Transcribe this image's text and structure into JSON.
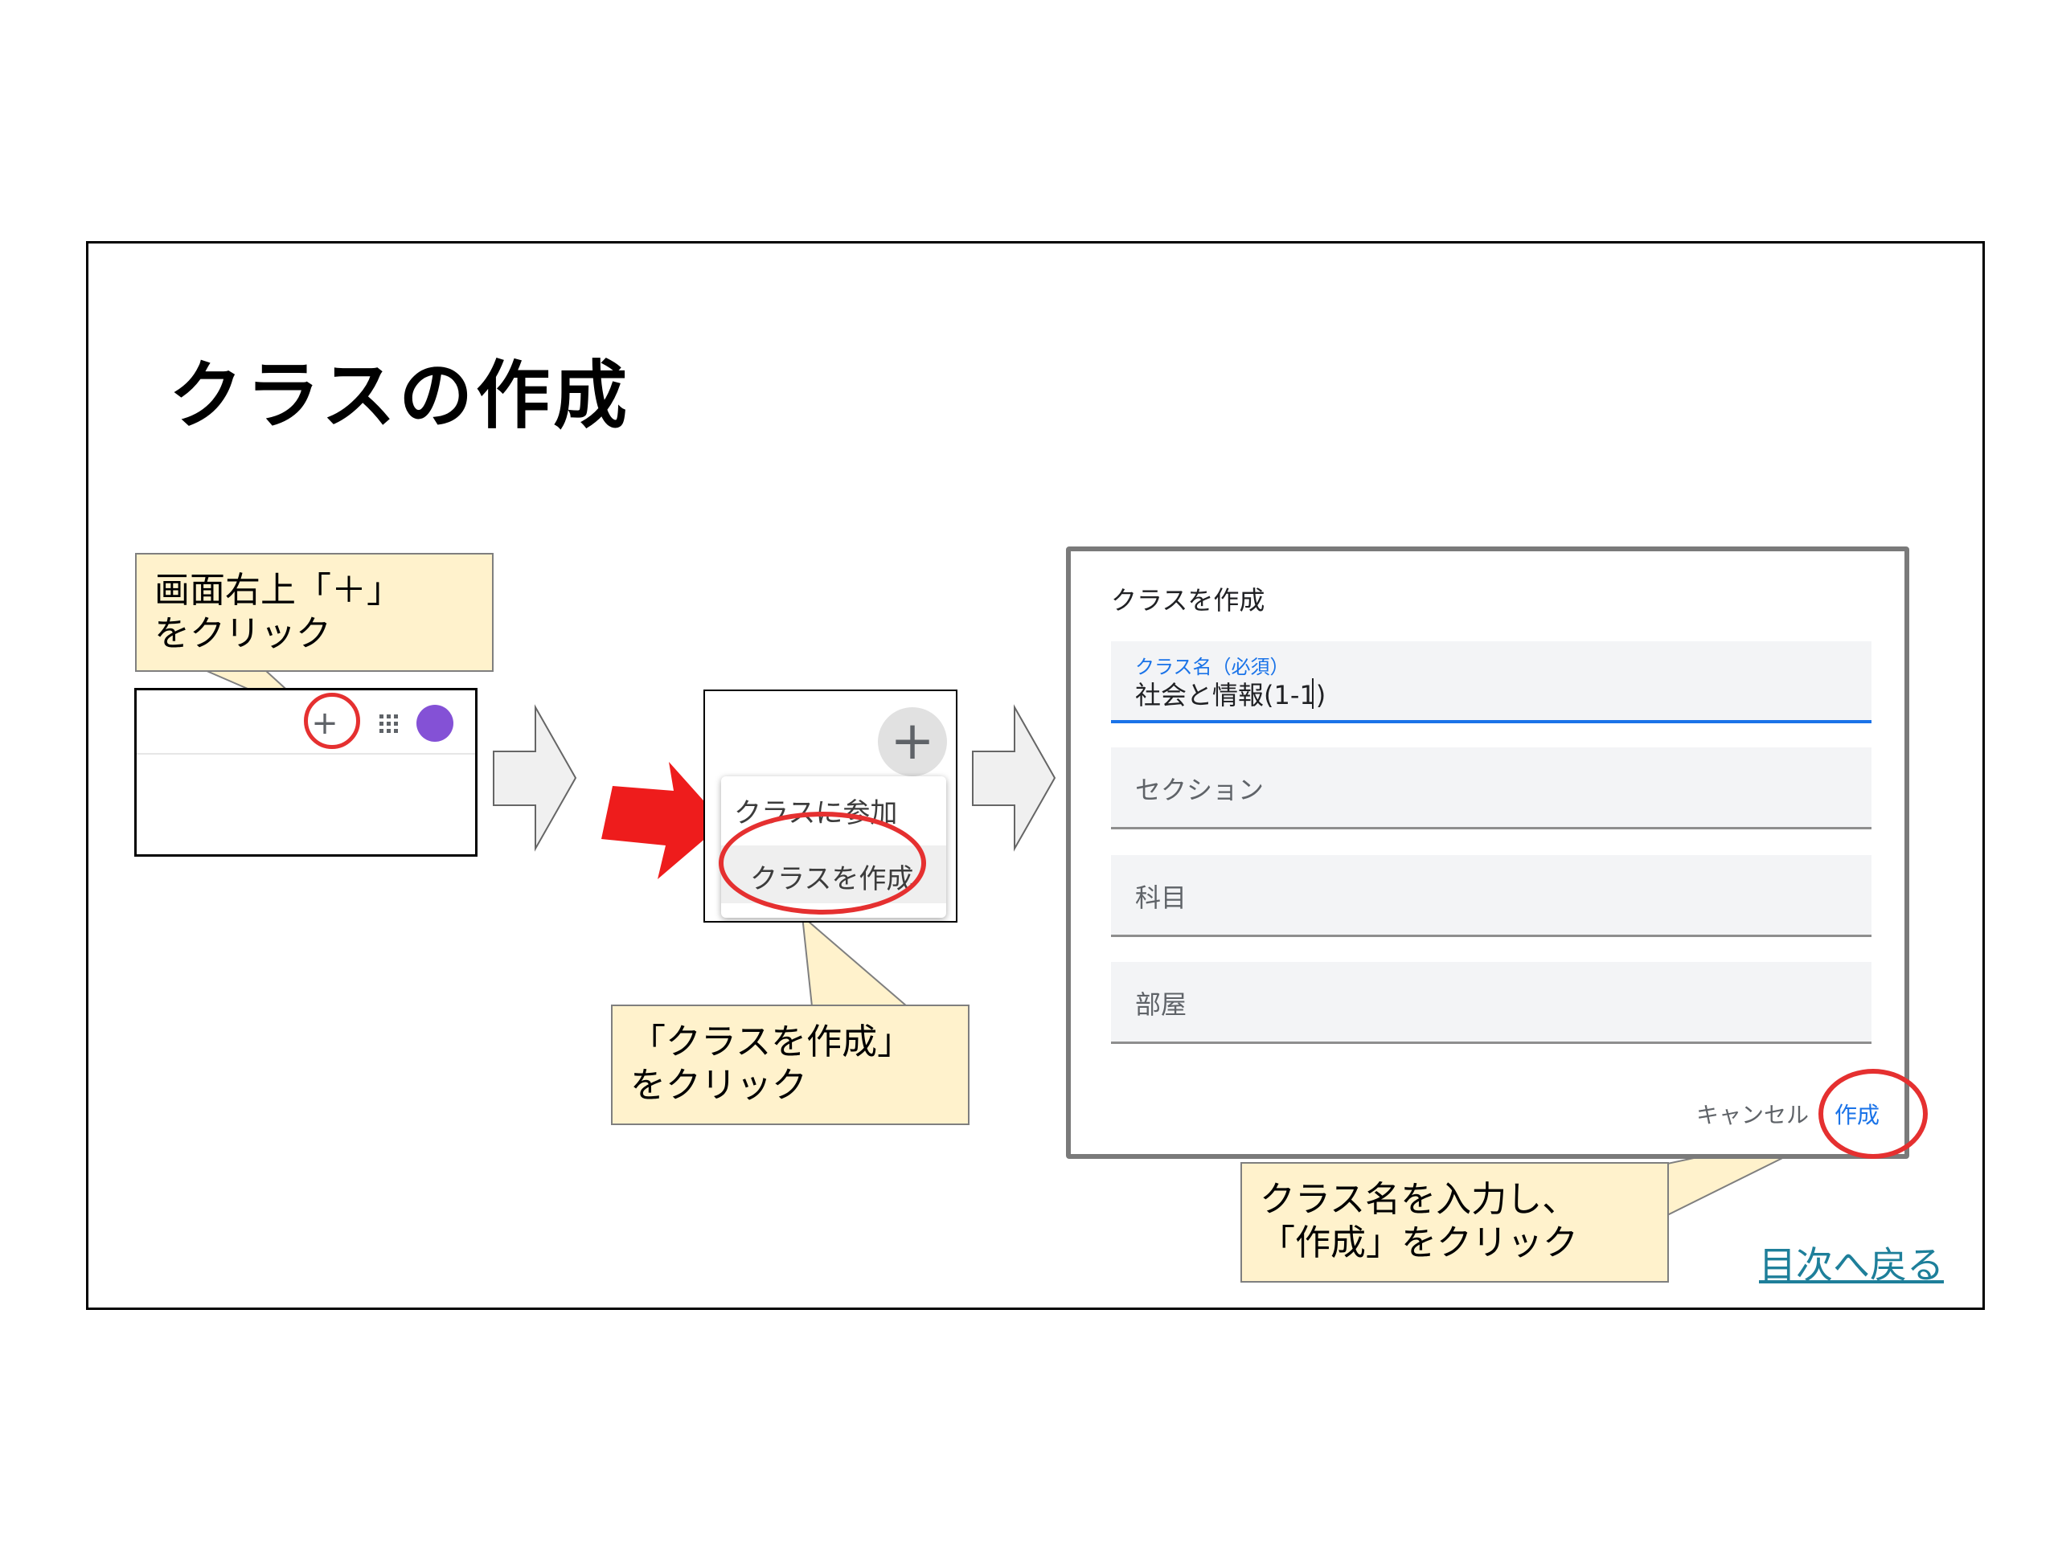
{
  "slide": {
    "title": "クラスの作成",
    "back_link": "目次へ戻る"
  },
  "callouts": {
    "step1": [
      "画面右上「＋」",
      "をクリック"
    ],
    "step2": [
      "「クラスを作成」",
      "をクリック"
    ],
    "step3": [
      "クラス名を入力し、",
      "「作成」をクリック"
    ]
  },
  "shot1": {
    "plus_icon": "+",
    "apps_icon": "⋮⋮⋮",
    "avatar_color": "#8451d6"
  },
  "shot2": {
    "plus_icon": "+",
    "menu": {
      "join": "クラスに参加",
      "create": "クラスを作成"
    }
  },
  "dialog": {
    "title": "クラスを作成",
    "class_name_label": "クラス名（必須）",
    "class_name_value": "社会と情報(1-1)",
    "section_placeholder": "セクション",
    "subject_placeholder": "科目",
    "room_placeholder": "部屋",
    "cancel": "キャンセル",
    "create": "作成"
  },
  "colors": {
    "highlight_red": "#e53030",
    "callout_fill": "#fff2cc",
    "link": "#1e7f9a",
    "accent_blue": "#1a73e8"
  },
  "icons": [
    "plus-icon",
    "apps-grid-icon",
    "red-arrow-icon",
    "flow-arrow-icon"
  ]
}
